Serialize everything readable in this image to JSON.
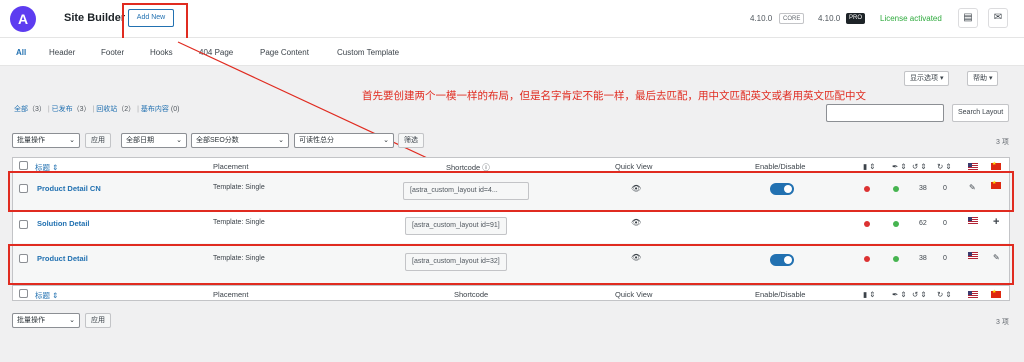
{
  "header": {
    "title": "Site Builder",
    "add_new": "Add New",
    "core_version": "4.10.0",
    "core_tag": "CORE",
    "pro_version": "4.10.0",
    "pro_tag": "PRO",
    "license": "License activated"
  },
  "tabs": [
    "All",
    "Header",
    "Footer",
    "Hooks",
    "404 Page",
    "Page Content",
    "Custom Template"
  ],
  "screen_options": "显示选项 ▾",
  "help": "帮助 ▾",
  "subsubsub": {
    "all": "全部",
    "all_count": "（3）",
    "published": "已发布",
    "published_count": "（3）",
    "trash": "回收站",
    "trash_count": "（2）",
    "elementor": "基布内容",
    "elementor_count": "(0)"
  },
  "annotation": "首先要创建两个一模一样的布局，但是名字肯定不能一样，最后去匹配，用中文匹配英文或者用英文匹配中文",
  "search_button": "Search Layout",
  "filters": {
    "bulk": "批量操作",
    "apply": "应用",
    "dates": "全部日期",
    "seo": "全部SEO分数",
    "readability": "可读性总分",
    "filter": "筛选"
  },
  "items_count": "3 项",
  "columns": {
    "title": "标题",
    "placement": "Placement",
    "shortcode": "Shortcode",
    "quick_view": "Quick View",
    "enable": "Enable/Disable"
  },
  "rows": [
    {
      "title": "Product Detail CN",
      "placement": "Template: Single",
      "shortcode": "[astra_custom_layout id=4...",
      "links_in": "38",
      "links_out": "0"
    },
    {
      "title": "Solution Detail",
      "placement": "Template: Single",
      "shortcode": "[astra_custom_layout id=91]",
      "links_in": "62",
      "links_out": "0"
    },
    {
      "title": "Product Detail",
      "placement": "Template: Single",
      "shortcode": "[astra_custom_layout id=32]",
      "links_in": "38",
      "links_out": "0"
    }
  ],
  "footer_bulk": "批量操作",
  "footer_apply": "应用",
  "footer_items_count": "3 项"
}
